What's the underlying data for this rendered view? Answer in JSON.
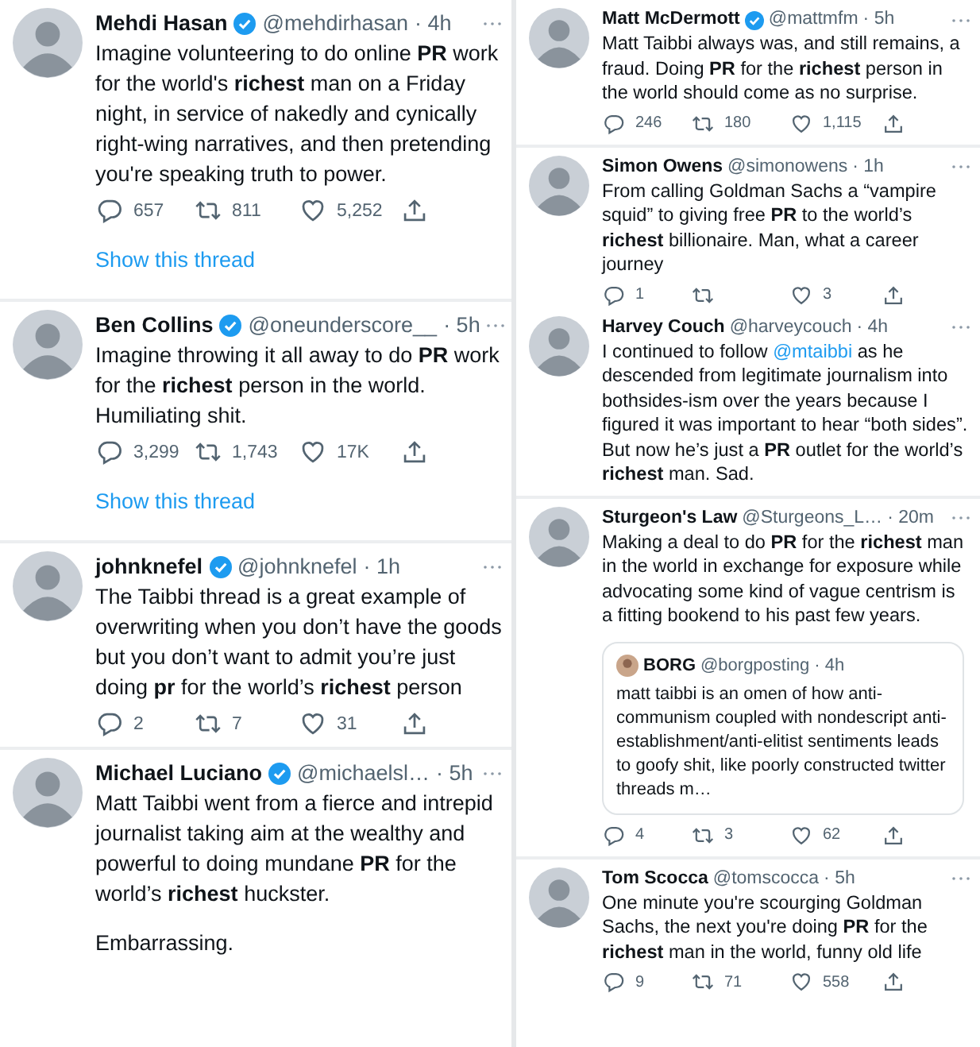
{
  "columns": [
    {
      "tweets": [
        {
          "name": "Mehdi Hasan",
          "verified": true,
          "handle": "@mehdirhasan",
          "time": "· 4h",
          "paragraphs": [
            [
              {
                "kind": "text",
                "text": "Imagine volunteering to do online **PR** work for the world's **richest** man on a Friday night, in service of nakedly and cynically right-wing narratives, and then pretending you're speaking truth to power."
              }
            ]
          ],
          "stats": {
            "replies": "657",
            "retweets": "811",
            "likes": "5,252"
          },
          "show_thread": "Show this thread"
        },
        {
          "name": "Ben Collins",
          "verified": true,
          "handle": "@oneunderscore__",
          "time": "· 5h",
          "paragraphs": [
            [
              {
                "kind": "text",
                "text": "Imagine throwing it all away to do **PR** work for the **richest** person in the world. Humiliating shit."
              }
            ]
          ],
          "stats": {
            "replies": "3,299",
            "retweets": "1,743",
            "likes": "17K"
          },
          "show_thread": "Show this thread"
        },
        {
          "name": "johnknefel",
          "verified": true,
          "handle": "@johnknefel",
          "time": "· 1h",
          "paragraphs": [
            [
              {
                "kind": "text",
                "text": "The Taibbi thread is a great example of overwriting when you don’t have the goods but you don’t want to admit you’re just doing **pr** for the world’s **richest** person"
              }
            ]
          ],
          "stats": {
            "replies": "2",
            "retweets": "7",
            "likes": "31"
          }
        },
        {
          "name": "Michael Luciano",
          "verified": true,
          "handle": "@michaelsl…",
          "time": "· 5h",
          "paragraphs": [
            [
              {
                "kind": "text",
                "text": "Matt Taibbi went from a fierce and intrepid journalist taking aim at the wealthy and powerful to doing mundane **PR** for the world’s **richest** huckster."
              }
            ],
            [
              {
                "kind": "text",
                "text": "Embarrassing."
              }
            ]
          ]
        }
      ]
    },
    {
      "tweets": [
        {
          "name": "Matt McDermott",
          "verified": true,
          "handle": "@mattmfm",
          "time": "· 5h",
          "paragraphs": [
            [
              {
                "kind": "text",
                "text": "Matt Taibbi always was, and still remains, a fraud. Doing **PR** for the **richest** person in the world should come as no surprise."
              }
            ]
          ],
          "stats": {
            "replies": "246",
            "retweets": "180",
            "likes": "1,115"
          }
        },
        {
          "name": "Simon Owens",
          "verified": false,
          "handle": "@simonowens",
          "time": "· 1h",
          "paragraphs": [
            [
              {
                "kind": "text",
                "text": "From calling Goldman Sachs a “vampire squid” to giving free **PR** to the world’s **richest** billionaire. Man, what a career journey"
              }
            ]
          ],
          "stats": {
            "replies": "1",
            "likes": "3"
          }
        },
        {
          "name": "Harvey Couch",
          "verified": false,
          "handle": "@harveycouch",
          "time": "· 4h",
          "paragraphs": [
            [
              {
                "kind": "text",
                "text": "I continued to follow "
              },
              {
                "kind": "mention",
                "text": "@mtaibbi"
              },
              {
                "kind": "text",
                "text": " as he descended from legitimate journalism into bothsides-ism over the years because I figured it was important to hear “both sides”. But now he’s just a **PR** outlet for the world’s **richest** man. Sad."
              }
            ]
          ]
        },
        {
          "name": "Sturgeon's Law",
          "verified": false,
          "handle": "@Sturgeons_L…",
          "time": "· 20m",
          "paragraphs": [
            [
              {
                "kind": "text",
                "text": "Making a deal to do **PR** for the **richest** man in the world in exchange for exposure while advocating some kind of vague centrism is a fitting bookend to his past few years."
              }
            ]
          ],
          "quote": {
            "name": "BORG",
            "handle": "@borgposting",
            "time": "· 4h",
            "text": "matt taibbi is an omen of how anti-communism coupled with nondescript anti-establishment/anti-elitist sentiments leads to goofy shit, like poorly constructed twitter threads m…"
          },
          "stats": {
            "replies": "4",
            "retweets": "3",
            "likes": "62"
          }
        },
        {
          "name": "Tom Scocca",
          "verified": false,
          "handle": "@tomscocca",
          "time": "· 5h",
          "paragraphs": [
            [
              {
                "kind": "text",
                "text": "One minute you're scourging Goldman Sachs, the next you're doing **PR** for the **richest** man in the world, funny old life"
              }
            ]
          ],
          "stats": {
            "replies": "9",
            "retweets": "71",
            "likes": "558"
          }
        }
      ]
    }
  ]
}
